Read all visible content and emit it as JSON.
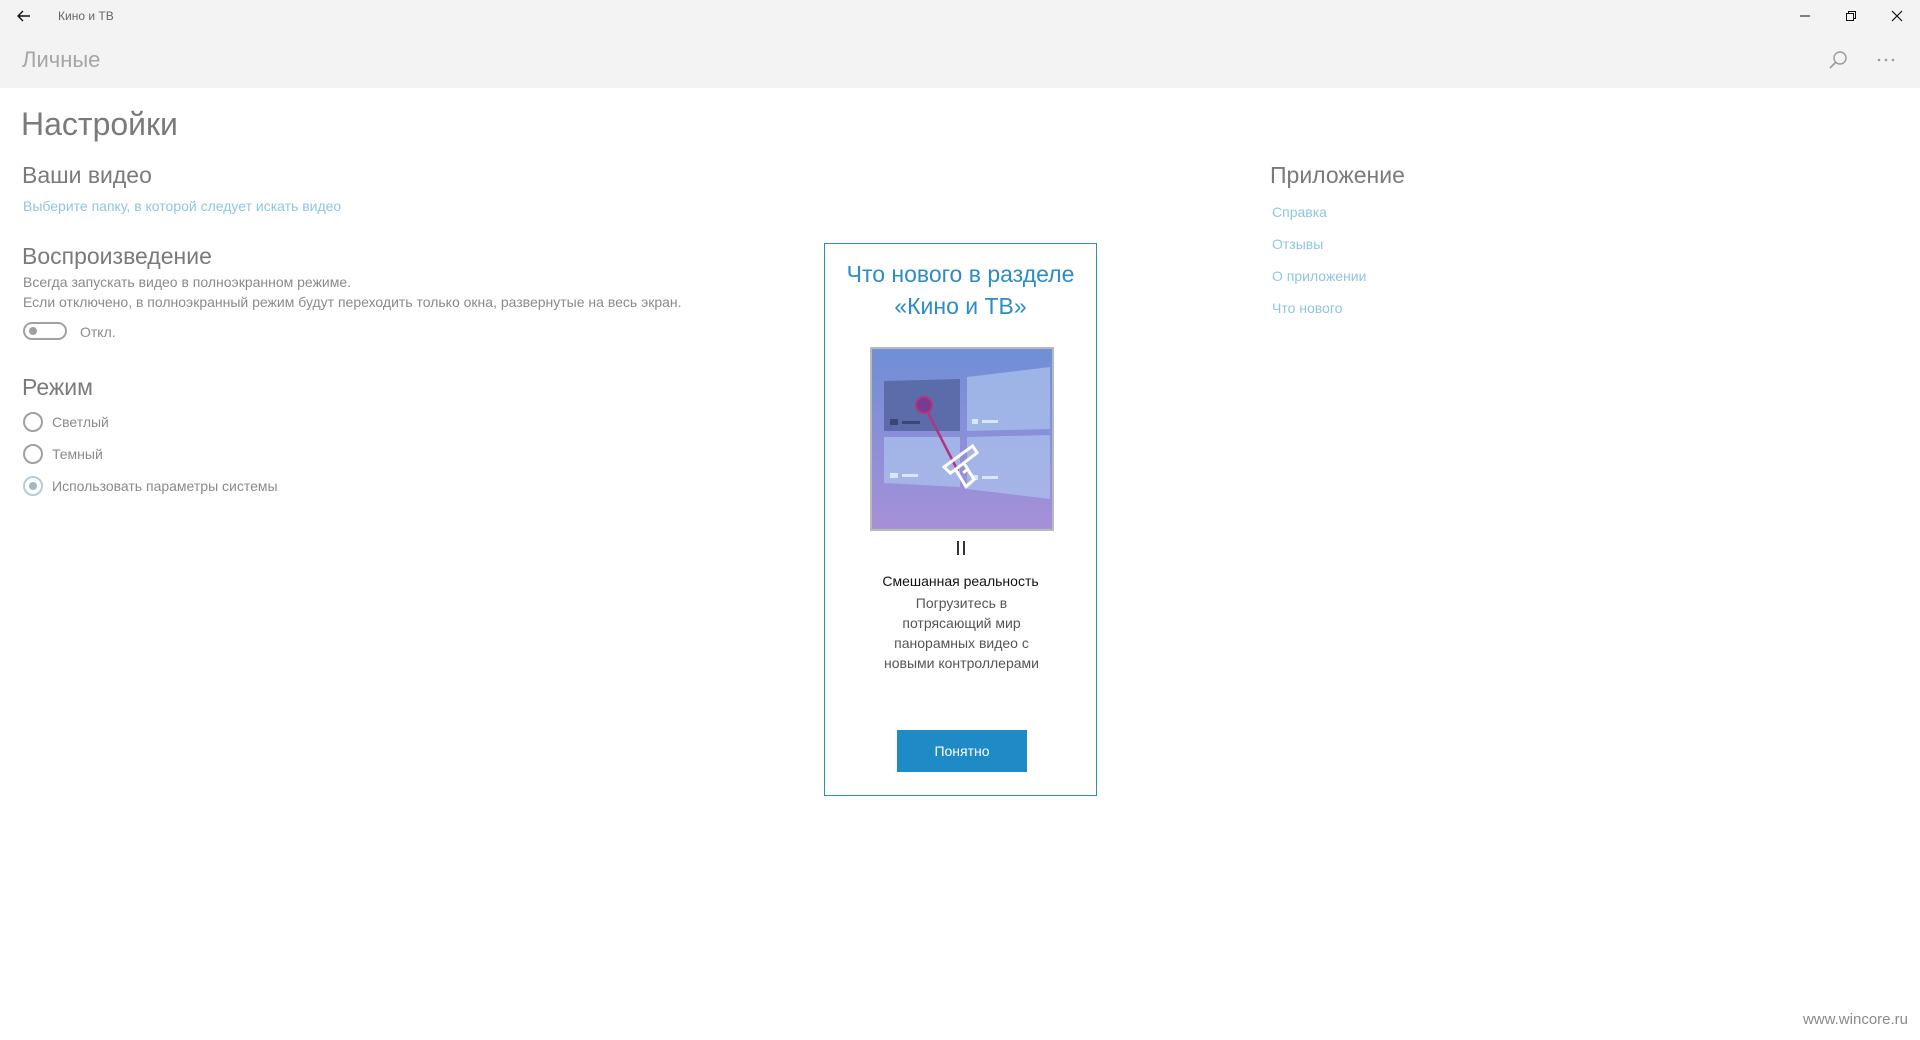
{
  "window": {
    "title": "Кино и ТВ",
    "back_icon": "arrow-left-icon",
    "minimize_icon": "minimize-icon",
    "restore_icon": "restore-icon",
    "close_icon": "close-icon"
  },
  "nav": {
    "title": "Личные",
    "search_icon": "search-icon",
    "more_icon": "more-icon"
  },
  "settings": {
    "page_title": "Настройки",
    "your_videos": {
      "title": "Ваши видео",
      "link": "Выберите папку, в которой следует искать видео"
    },
    "playback": {
      "title": "Воспроизведение",
      "line1": "Всегда запускать видео в полноэкранном режиме.",
      "line2": "Если отключено, в полноэкранный режим будут переходить только окна, развернутые на весь экран.",
      "toggle_label": "Откл.",
      "toggle_on": false
    },
    "mode": {
      "title": "Режим",
      "options": [
        {
          "label": "Светлый",
          "checked": false
        },
        {
          "label": "Темный",
          "checked": false
        },
        {
          "label": "Использовать параметры системы",
          "checked": true
        }
      ]
    },
    "app": {
      "title": "Приложение",
      "links": [
        "Справка",
        "Отзывы",
        "О приложении",
        "Что нового"
      ]
    }
  },
  "dialog": {
    "title": "Что нового в разделе «Кино и ТВ»",
    "subtitle": "Смешанная реальность",
    "text": "Погрузитесь в потрясающий мир панорамных видео с новыми контроллерами",
    "button": "Понятно",
    "pause_icon": "pause-icon"
  },
  "watermark": "www.wincore.ru",
  "colors": {
    "accent": "#2b8cc6",
    "button": "#1e8ac6",
    "link": "#8ec6df"
  }
}
